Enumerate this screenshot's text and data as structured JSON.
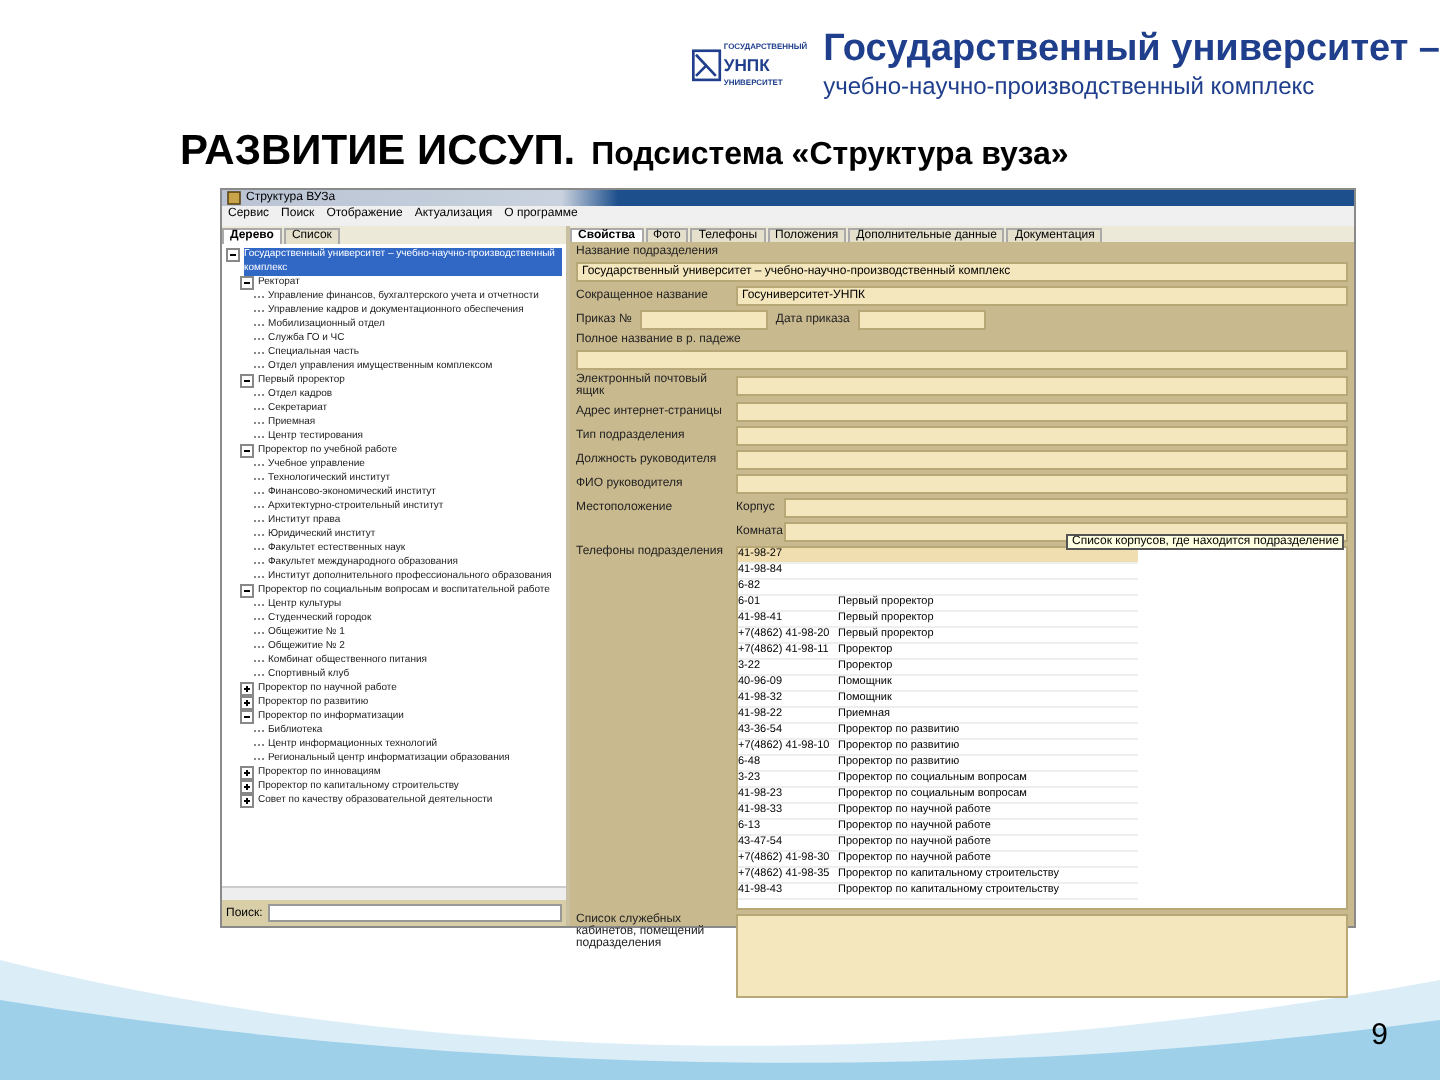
{
  "logo": {
    "top": "ГОСУДАРСТВЕННЫЙ",
    "mid": "УНПК",
    "bottom": "УНИВЕРСИТЕТ"
  },
  "org": {
    "name": "Государственный университет –",
    "subtitle": "учебно-научно-производственный комплекс"
  },
  "slide_title": {
    "main": "РАЗВИТИЕ ИССУП.",
    "sub": "Подсистема «Структура вуза»"
  },
  "window": {
    "title": "Структура ВУЗа"
  },
  "menu": [
    "Сервис",
    "Поиск",
    "Отображение",
    "Актуализация",
    "О программе"
  ],
  "left_tabs": [
    {
      "label": "Дерево",
      "selected": true
    },
    {
      "label": "Список",
      "selected": false
    }
  ],
  "tree": [
    {
      "label": "Государственный университет – учебно-научно-производственный комплекс",
      "selected": true,
      "expanded": true,
      "children": [
        {
          "label": "Ректорат",
          "selected": false,
          "expanded": true,
          "children": [
            {
              "label": "Управление финансов, бухгалтерского учета и отчетности",
              "selected": false
            },
            {
              "label": "Управление кадров и документационного обеспечения",
              "selected": false
            },
            {
              "label": "Мобилизационный отдел",
              "selected": false
            },
            {
              "label": "Служба ГО и ЧС",
              "selected": false
            },
            {
              "label": "Специальная часть",
              "selected": false
            },
            {
              "label": "Отдел управления имущественным комплексом",
              "selected": false
            }
          ]
        },
        {
          "label": "Первый проректор",
          "selected": false,
          "expanded": true,
          "children": [
            {
              "label": "Отдел кадров",
              "selected": false
            },
            {
              "label": "Секретариат",
              "selected": false
            },
            {
              "label": "Приемная",
              "selected": false
            },
            {
              "label": "Центр тестирования",
              "selected": false
            }
          ]
        },
        {
          "label": "Проректор по учебной работе",
          "selected": false,
          "expanded": true,
          "children": [
            {
              "label": "Учебное управление",
              "selected": false
            },
            {
              "label": "Технологический институт",
              "selected": false
            },
            {
              "label": "Финансово-экономический институт",
              "selected": false
            },
            {
              "label": "Архитектурно-строительный институт",
              "selected": false
            },
            {
              "label": "Институт права",
              "selected": false
            },
            {
              "label": "Юридический институт",
              "selected": false
            },
            {
              "label": "Факультет естественных наук",
              "selected": false
            },
            {
              "label": "Факультет международного образования",
              "selected": false
            },
            {
              "label": "Институт дополнительного профессионального образования",
              "selected": false
            }
          ]
        },
        {
          "label": "Проректор по социальным вопросам и воспитательной работе",
          "selected": false,
          "expanded": true,
          "children": [
            {
              "label": "Центр культуры",
              "selected": false
            },
            {
              "label": "Студенческий городок",
              "selected": false
            },
            {
              "label": "Общежитие № 1",
              "selected": false
            },
            {
              "label": "Общежитие № 2",
              "selected": false
            },
            {
              "label": "Комбинат общественного питания",
              "selected": false
            },
            {
              "label": "Спортивный клуб",
              "selected": false
            }
          ]
        },
        {
          "label": "Проректор по научной работе",
          "selected": false,
          "expanded": false
        },
        {
          "label": "Проректор по развитию",
          "selected": false,
          "expanded": false
        },
        {
          "label": "Проректор по информатизации",
          "selected": false,
          "expanded": true,
          "children": [
            {
              "label": "Библиотека",
              "selected": false
            },
            {
              "label": "Центр информационных технологий",
              "selected": false
            },
            {
              "label": "Региональный центр информатизации образования",
              "selected": false
            }
          ]
        },
        {
          "label": "Проректор по инновациям",
          "selected": false,
          "expanded": false
        },
        {
          "label": "Проректор по капитальному строительству",
          "selected": false,
          "expanded": false
        },
        {
          "label": "Совет по качеству образовательной деятельности",
          "selected": false,
          "expanded": false
        }
      ]
    }
  ],
  "search": {
    "label": "Поиск:"
  },
  "right_tabs": [
    {
      "label": "Свойства",
      "selected": true
    },
    {
      "label": "Фото",
      "selected": false
    },
    {
      "label": "Телефоны",
      "selected": false
    },
    {
      "label": "Положения",
      "selected": false
    },
    {
      "label": "Дополнительные данные",
      "selected": false
    },
    {
      "label": "Документация",
      "selected": false
    }
  ],
  "properties": {
    "name_label": "Название подразделения",
    "name_value": "Государственный университет – учебно-научно-производственный комплекс",
    "short_label": "Сокращенное название",
    "short_value": "Госуниверситет-УНПК",
    "order_label": "Приказ №",
    "date_label": "Дата приказа",
    "genitive_label": "Полное название в р. падеже",
    "rows": [
      {
        "label": "Электронный почтовый ящик"
      },
      {
        "label": "Адрес интернет-страницы"
      },
      {
        "label": "Тип подразделения"
      },
      {
        "label": "Должность руководителя"
      },
      {
        "label": "ФИО руководителя"
      }
    ],
    "location_label": "Местоположение",
    "building_label": "Корпус",
    "room_label": "Комната",
    "tooltip": "Список корпусов, где находится подразделение",
    "phones_label": "Телефоны подразделения",
    "rooms_label": "Список служебных кабинетов, помещений подразделения"
  },
  "phones": [
    {
      "number": "41-98-27",
      "selected": true
    },
    {
      "number": "41-98-84",
      "selected": false
    },
    {
      "number": "6-82",
      "selected": false
    },
    {
      "number": "6-01",
      "note": "Первый проректор",
      "selected": false
    },
    {
      "number": "41-98-41",
      "note": "Первый проректор",
      "selected": false
    },
    {
      "number": "+7(4862) 41-98-20",
      "note": "Первый проректор",
      "selected": false
    },
    {
      "number": "+7(4862) 41-98-11",
      "note": "Проректор",
      "selected": false
    },
    {
      "number": "3-22",
      "note": "Проректор",
      "selected": false
    },
    {
      "number": "40-96-09",
      "note": "Помощник",
      "selected": false
    },
    {
      "number": "41-98-32",
      "note": "Помощник",
      "selected": false
    },
    {
      "number": "41-98-22",
      "note": "Приемная",
      "selected": false
    },
    {
      "number": "43-36-54",
      "note": "Проректор по развитию",
      "selected": false
    },
    {
      "number": "+7(4862) 41-98-10",
      "note": "Проректор по развитию",
      "selected": false
    },
    {
      "number": "6-48",
      "note": "Проректор по развитию",
      "selected": false
    },
    {
      "number": "3-23",
      "note": "Проректор по социальным вопросам",
      "selected": false
    },
    {
      "number": "41-98-23",
      "note": "Проректор по социальным вопросам",
      "selected": false
    },
    {
      "number": "41-98-33",
      "note": "Проректор по научной работе",
      "selected": false
    },
    {
      "number": "6-13",
      "note": "Проректор по научной работе",
      "selected": false
    },
    {
      "number": "43-47-54",
      "note": "Проректор по научной работе",
      "selected": false
    },
    {
      "number": "+7(4862) 41-98-30",
      "note": "Проректор по научной работе",
      "selected": false
    },
    {
      "number": "+7(4862) 41-98-35",
      "note": "Проректор по капитальному строительству",
      "selected": false
    },
    {
      "number": "41-98-43",
      "note": "Проректор по капитальному строительству",
      "selected": false
    }
  ],
  "page_number": "9"
}
